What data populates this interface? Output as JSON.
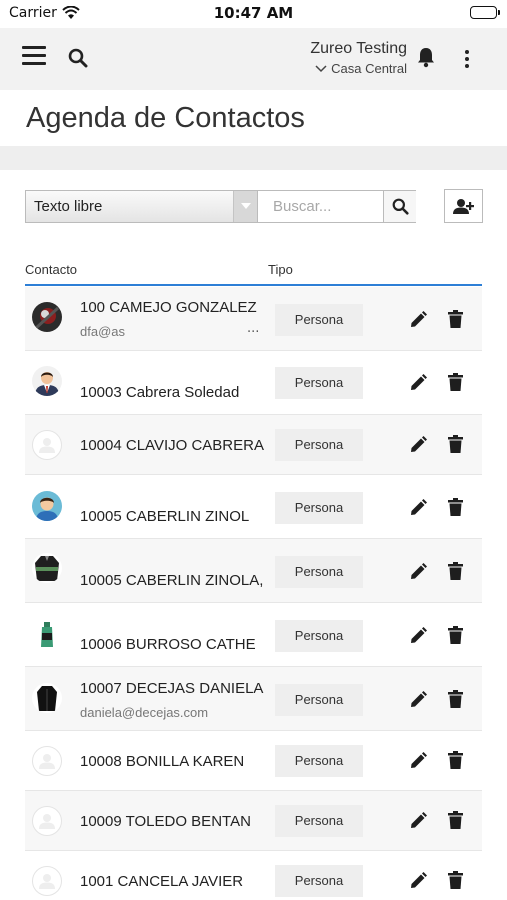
{
  "status": {
    "carrier": "Carrier",
    "time": "10:47 AM"
  },
  "header": {
    "company": "Zureo Testing",
    "branch": "Casa Central"
  },
  "page": {
    "title": "Agenda de Contactos"
  },
  "filter": {
    "selected": "Texto libre",
    "search_placeholder": "Buscar..."
  },
  "table": {
    "headers": {
      "contact": "Contacto",
      "type": "Tipo"
    },
    "rows": [
      {
        "name": "100 CAMEJO GONZALEZ",
        "email": "dfa@as",
        "type": "Persona",
        "more": "...",
        "avatar": "photo-dark"
      },
      {
        "name": "10003 Cabrera Soledad",
        "email": "",
        "type": "Persona",
        "avatar": "man-suit"
      },
      {
        "name": "10004 CLAVIJO CABRERA",
        "email": "",
        "type": "Persona",
        "avatar": "placeholder"
      },
      {
        "name": "10005 CABERLIN ZINOL",
        "email": "",
        "type": "Persona",
        "avatar": "boy"
      },
      {
        "name": "10005 CABERLIN ZINOLA,",
        "email": "",
        "type": "Persona",
        "avatar": "jacket-green"
      },
      {
        "name": "10006 BURROSO CATHE",
        "email": "",
        "type": "Persona",
        "avatar": "bottle"
      },
      {
        "name": "10007 DECEJAS DANIELA",
        "email": "daniela@decejas.com",
        "type": "Persona",
        "avatar": "jacket-black"
      },
      {
        "name": "10008 BONILLA KAREN",
        "email": "",
        "type": "Persona",
        "avatar": "placeholder"
      },
      {
        "name": "10009 TOLEDO BENTAN",
        "email": "",
        "type": "Persona",
        "avatar": "placeholder"
      },
      {
        "name": "1001 CANCELA JAVIER",
        "email": "",
        "type": "Persona",
        "avatar": "placeholder"
      }
    ]
  },
  "colors": {
    "accent": "#2d7fd6",
    "appbar": "#f2f2f2"
  },
  "icons": {
    "menu": "hamburger-icon",
    "search": "search-icon",
    "bell": "bell-icon",
    "more": "kebab-icon",
    "add_user": "add-user-icon",
    "edit": "pencil-icon",
    "delete": "trash-icon"
  }
}
